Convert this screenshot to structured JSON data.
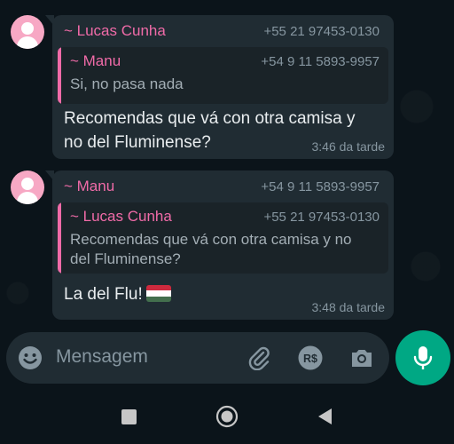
{
  "messages": [
    {
      "sender_name": "~ Lucas Cunha",
      "sender_phone": "+55 21 97453-0130",
      "quote": {
        "name": "~ Manu",
        "phone": "+54 9 11 5893-9957",
        "text": "Si, no pasa nada"
      },
      "text_line1": "Recomendas que vá con otra camisa y",
      "text_line2": "no del Fluminense?",
      "time": "3:46 da tarde"
    },
    {
      "sender_name": "~ Manu",
      "sender_phone": "+54 9 11 5893-9957",
      "quote": {
        "name": "~ Lucas Cunha",
        "phone": "+55 21 97453-0130",
        "text_line1": "Recomendas que vá con otra camisa y no",
        "text_line2": "del Fluminense?"
      },
      "text": "La del Flu!",
      "emoji": "flag-hungary",
      "time": "3:48 da tarde"
    }
  ],
  "input": {
    "placeholder": "Mensagem",
    "icons": [
      "emoji-icon",
      "attach-icon",
      "payment-icon",
      "camera-icon",
      "mic-icon"
    ]
  },
  "colors": {
    "background": "#0b141a",
    "bubble": "#202c33",
    "accent_name": "#f06ba8",
    "mic_button": "#00a884"
  },
  "navbar": {
    "icons": [
      "recents-icon",
      "home-icon",
      "back-icon"
    ]
  }
}
